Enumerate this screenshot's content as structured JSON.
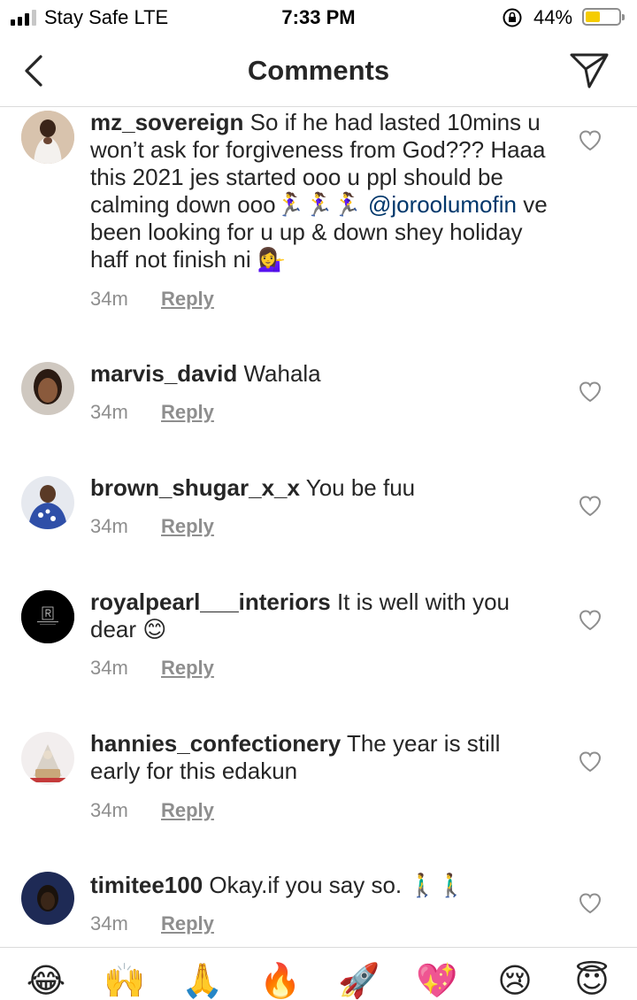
{
  "status_bar": {
    "carrier": "Stay Safe  LTE",
    "time": "7:33 PM",
    "battery_percent": "44%",
    "battery_level": 0.44,
    "battery_color": "#f5cc00"
  },
  "header": {
    "title": "Comments",
    "back_icon": "chevron-left-icon",
    "send_icon": "direct-send-icon"
  },
  "comments": [
    {
      "username": "mz_sovereign",
      "text_before": "So if he had lasted 10mins u won’t ask for forgiveness from God??? Haaa this 2021 jes started ooo u ppl should be calming down ooo🏃‍♀️🏃‍♀️🏃‍♀️",
      "mention": "@joroolumofin",
      "text_after": "ve been looking for u up & down shey holiday haff not finish ni 💁‍♀️",
      "time": "34m",
      "reply_label": "Reply"
    },
    {
      "username": "marvis_david",
      "text": "Wahala",
      "time": "34m",
      "reply_label": "Reply"
    },
    {
      "username": "brown_shugar_x_x",
      "text": "You be fuu",
      "time": "34m",
      "reply_label": "Reply"
    },
    {
      "username": "royalpearl___interiors",
      "text": "It is well with you dear 😊",
      "time": "34m",
      "reply_label": "Reply"
    },
    {
      "username": "hannies_confectionery",
      "text": "The year is still early for this edakun",
      "time": "34m",
      "reply_label": "Reply"
    },
    {
      "username": "timitee100",
      "text": "Okay.if you say so. 🚶‍♂️🚶‍♂️",
      "time": "34m",
      "reply_label": "Reply"
    }
  ],
  "quick_emojis": [
    "😂",
    "🙌",
    "🙏",
    "🔥",
    "🚀",
    "💖",
    "😢",
    "😇"
  ],
  "colors": {
    "text": "#262626",
    "secondary": "#8e8e8e",
    "mention": "#00376b",
    "divider": "#dbdbdb"
  }
}
